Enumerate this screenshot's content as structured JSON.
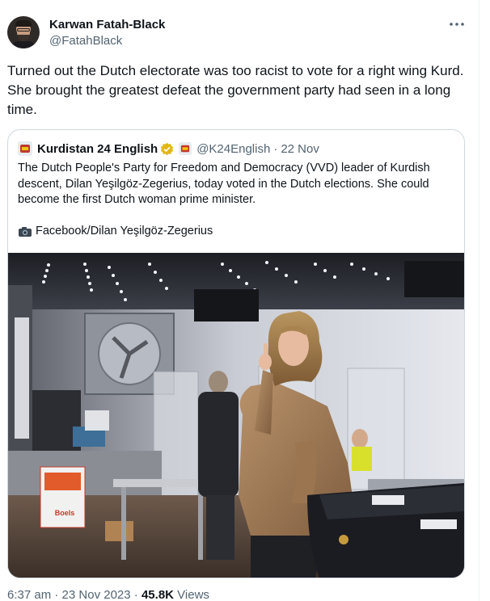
{
  "tweet": {
    "author_name": "Karwan Fatah-Black",
    "author_handle": "@FatahBlack",
    "more_icon": "more-horizontal-icon",
    "text": "Turned out the Dutch electorate was too racist to vote for a right wing Kurd. She brought the greatest defeat the government party had seen in a long time.",
    "time": "6:37 am",
    "separator": "·",
    "date": "23 Nov 2023",
    "views_count": "45.8K",
    "views_label": "Views"
  },
  "quote": {
    "author_name": "Kurdistan 24 English",
    "verified_icon": "verified-gold-badge-icon",
    "handle": "@K24English",
    "separator": "·",
    "date": "22 Nov",
    "text": "The Dutch People's Party for Freedom and Democracy (VVD) leader of Kurdish descent, Dilan Yeşilgöz-Zegerius, today voted in the Dutch elections. She could become the first Dutch woman prime minister.",
    "credit_icon": "camera-icon",
    "credit": "Facebook/Dilan Yeşilgöz-Zegerius",
    "photo_sign_text": "Boels"
  },
  "colors": {
    "text_primary": "#0f1419",
    "text_secondary": "#536471",
    "border": "#cfd9de",
    "verified_gold": "#e2b719"
  }
}
